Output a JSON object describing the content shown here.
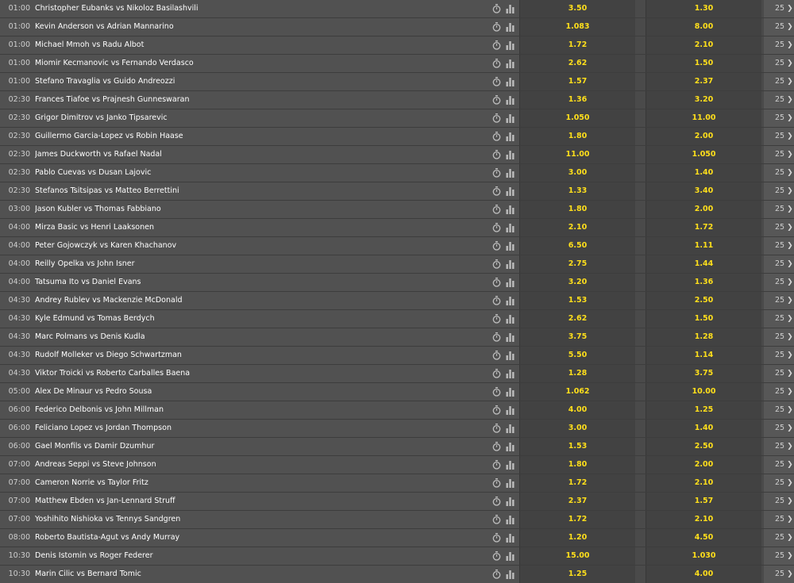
{
  "colors": {
    "odds_text": "#ffdf1b",
    "row_bg": "#515151",
    "odds_bg": "#424242",
    "text": "#ffffff"
  },
  "icons": {
    "live": "stopwatch-icon",
    "stats": "bar-chart-icon",
    "more": "chevron-right-icon"
  },
  "events": [
    {
      "time": "01:00",
      "match": "Christopher Eubanks vs Nikoloz Basilashvili",
      "odds1": "3.50",
      "odds2": "1.30",
      "markets": "25"
    },
    {
      "time": "01:00",
      "match": "Kevin Anderson vs Adrian Mannarino",
      "odds1": "1.083",
      "odds2": "8.00",
      "markets": "25"
    },
    {
      "time": "01:00",
      "match": "Michael Mmoh vs Radu Albot",
      "odds1": "1.72",
      "odds2": "2.10",
      "markets": "25"
    },
    {
      "time": "01:00",
      "match": "Miomir Kecmanovic vs Fernando Verdasco",
      "odds1": "2.62",
      "odds2": "1.50",
      "markets": "25"
    },
    {
      "time": "01:00",
      "match": "Stefano Travaglia vs Guido Andreozzi",
      "odds1": "1.57",
      "odds2": "2.37",
      "markets": "25"
    },
    {
      "time": "02:30",
      "match": "Frances Tiafoe vs Prajnesh Gunneswaran",
      "odds1": "1.36",
      "odds2": "3.20",
      "markets": "25"
    },
    {
      "time": "02:30",
      "match": "Grigor Dimitrov vs Janko Tipsarevic",
      "odds1": "1.050",
      "odds2": "11.00",
      "markets": "25"
    },
    {
      "time": "02:30",
      "match": "Guillermo Garcia-Lopez vs Robin Haase",
      "odds1": "1.80",
      "odds2": "2.00",
      "markets": "25"
    },
    {
      "time": "02:30",
      "match": "James Duckworth vs Rafael Nadal",
      "odds1": "11.00",
      "odds2": "1.050",
      "markets": "25"
    },
    {
      "time": "02:30",
      "match": "Pablo Cuevas vs Dusan Lajovic",
      "odds1": "3.00",
      "odds2": "1.40",
      "markets": "25"
    },
    {
      "time": "02:30",
      "match": "Stefanos Tsitsipas vs Matteo Berrettini",
      "odds1": "1.33",
      "odds2": "3.40",
      "markets": "25"
    },
    {
      "time": "03:00",
      "match": "Jason Kubler vs Thomas Fabbiano",
      "odds1": "1.80",
      "odds2": "2.00",
      "markets": "25"
    },
    {
      "time": "04:00",
      "match": "Mirza Basic vs Henri Laaksonen",
      "odds1": "2.10",
      "odds2": "1.72",
      "markets": "25"
    },
    {
      "time": "04:00",
      "match": "Peter Gojowczyk vs Karen Khachanov",
      "odds1": "6.50",
      "odds2": "1.11",
      "markets": "25"
    },
    {
      "time": "04:00",
      "match": "Reilly Opelka vs John Isner",
      "odds1": "2.75",
      "odds2": "1.44",
      "markets": "25"
    },
    {
      "time": "04:00",
      "match": "Tatsuma Ito vs Daniel Evans",
      "odds1": "3.20",
      "odds2": "1.36",
      "markets": "25"
    },
    {
      "time": "04:30",
      "match": "Andrey Rublev vs Mackenzie McDonald",
      "odds1": "1.53",
      "odds2": "2.50",
      "markets": "25"
    },
    {
      "time": "04:30",
      "match": "Kyle Edmund vs Tomas Berdych",
      "odds1": "2.62",
      "odds2": "1.50",
      "markets": "25"
    },
    {
      "time": "04:30",
      "match": "Marc Polmans vs Denis Kudla",
      "odds1": "3.75",
      "odds2": "1.28",
      "markets": "25"
    },
    {
      "time": "04:30",
      "match": "Rudolf Molleker vs Diego Schwartzman",
      "odds1": "5.50",
      "odds2": "1.14",
      "markets": "25"
    },
    {
      "time": "04:30",
      "match": "Viktor Troicki vs Roberto Carballes Baena",
      "odds1": "1.28",
      "odds2": "3.75",
      "markets": "25"
    },
    {
      "time": "05:00",
      "match": "Alex De Minaur vs Pedro Sousa",
      "odds1": "1.062",
      "odds2": "10.00",
      "markets": "25"
    },
    {
      "time": "06:00",
      "match": "Federico Delbonis vs John Millman",
      "odds1": "4.00",
      "odds2": "1.25",
      "markets": "25"
    },
    {
      "time": "06:00",
      "match": "Feliciano Lopez vs Jordan Thompson",
      "odds1": "3.00",
      "odds2": "1.40",
      "markets": "25"
    },
    {
      "time": "06:00",
      "match": "Gael Monfils vs Damir Dzumhur",
      "odds1": "1.53",
      "odds2": "2.50",
      "markets": "25"
    },
    {
      "time": "07:00",
      "match": "Andreas Seppi vs Steve Johnson",
      "odds1": "1.80",
      "odds2": "2.00",
      "markets": "25"
    },
    {
      "time": "07:00",
      "match": "Cameron Norrie vs Taylor Fritz",
      "odds1": "1.72",
      "odds2": "2.10",
      "markets": "25"
    },
    {
      "time": "07:00",
      "match": "Matthew Ebden vs Jan-Lennard Struff",
      "odds1": "2.37",
      "odds2": "1.57",
      "markets": "25"
    },
    {
      "time": "07:00",
      "match": "Yoshihito Nishioka vs Tennys Sandgren",
      "odds1": "1.72",
      "odds2": "2.10",
      "markets": "25"
    },
    {
      "time": "08:00",
      "match": "Roberto Bautista-Agut vs Andy Murray",
      "odds1": "1.20",
      "odds2": "4.50",
      "markets": "25"
    },
    {
      "time": "10:30",
      "match": "Denis Istomin vs Roger Federer",
      "odds1": "15.00",
      "odds2": "1.030",
      "markets": "25"
    },
    {
      "time": "10:30",
      "match": "Marin Cilic vs Bernard Tomic",
      "odds1": "1.25",
      "odds2": "4.00",
      "markets": "25"
    }
  ]
}
